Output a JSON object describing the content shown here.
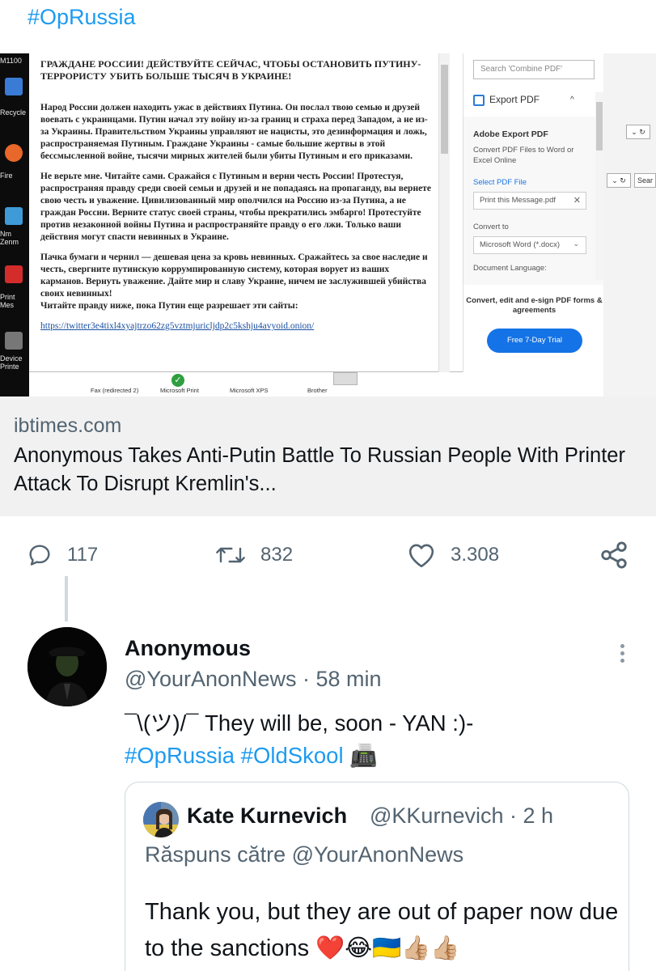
{
  "hashtag_top": "#OpRussia",
  "card_image": {
    "desktop_labels": [
      "M1100",
      "Recycle",
      "Fire",
      "Nm\nZenm",
      "Print\nMes",
      "Device\nPrinte"
    ],
    "document": {
      "heading": "ГРАЖДАНЕ РОССИИ! ДЕЙСТВУЙТЕ СЕЙЧАС, ЧТОБЫ ОСТАНОВИТЬ ПУТИНУ-ТЕРРОРИСТУ УБИТЬ БОЛЬШЕ ТЫСЯЧ В УКРАИНЕ!",
      "p1": "Народ России должен находить ужас в действиях Путина. Он послал твою семью и друзей воевать с украинцами. Путин начал эту войну из-за границ и страха перед Западом, а не из-за Украины. Правительством Украины управляют не нацисты, это дезинформация и ложь, распространяемая Путиным. Граждане Украины - самые большие жертвы в этой бессмысленной войне, тысячи мирных жителей были убиты Путиным и его приказами.",
      "p2": "Не верьте мне. Читайте сами. Сражайся с Путиным и верни честь России! Протестуя, распространяя правду среди своей семьи и друзей и не попадаясь на пропаганду, вы вернете свою честь и уважение. Цивилизованный мир ополчился на Россию из-за Путина, а не граждан России. Верните статус своей страны, чтобы прекратились эмбарго! Протестуйте против незаконной войны Путина и распространяйте правду о его лжи. Только ваши действия могут спасти невинных в Украине.",
      "p3": "Пачка бумаги и чернил — дешевая цена за кровь невинных. Сражайтесь за свое наследие и честь, свергните путинскую коррумпированную систему, которая ворует из ваших карманов. Вернуть уважение. Дайте мир и славу Украине, ничем не заслужившей убийства своих невинных!",
      "p4": "Читайте правду ниже, пока Путин еще разрешает эти сайты:",
      "link": "https://twitter3e4tixl4xyajtrzo62zg5vztmjuricljdp2c5kshju4avyoid.onion/"
    },
    "pdf_panel": {
      "search_placeholder": "Search 'Combine PDF'",
      "export_label": "Export PDF",
      "chevron": "^",
      "title": "Adobe Export PDF",
      "desc": "Convert PDF Files to Word or Excel Online",
      "select_file": "Select PDF File",
      "file_name": "Print this Message.pdf",
      "file_close": "✕",
      "convert_to": "Convert to",
      "format": "Microsoft Word (*.docx)",
      "format_arrow": "⌄",
      "doc_language": "Document Language:",
      "promo": "Convert, edit and e-sign PDF forms & agreements",
      "trial_button": "Free 7-Day Trial"
    },
    "right_controls": [
      "⌄ ↻",
      "⌄ ↻",
      "Sear"
    ],
    "printers": [
      "Fax (redirected 2)",
      "Microsoft Print",
      "Microsoft XPS",
      "Brother"
    ]
  },
  "card": {
    "domain": "ibtimes.com",
    "title": "Anonymous Takes Anti-Putin Battle To Russian People With Printer Attack To Disrupt Kremlin's..."
  },
  "actions": {
    "replies": "117",
    "retweets": "832",
    "likes": "3.308"
  },
  "reply_tweet": {
    "name": "Anonymous",
    "handle_time": "@YourAnonNews · 58 min",
    "text_plain": "¯\\(ツ)/¯ They will be, soon - YAN :)-",
    "tags": "#OpRussia #OldSkool",
    "tag_emoji": "📠"
  },
  "quoted_tweet": {
    "name": "Kate Kurnevich",
    "handle_time": "@KKurnevich · 2 h",
    "reply_to": "Răspuns către @YourAnonNews",
    "text": "Thank you, but they are out of paper now due to the sanctions",
    "emoji": "❤️😂🇺🇦👍🏼👍🏼"
  },
  "colors": {
    "link_blue": "#1d9bf0",
    "muted_gray": "#536471",
    "card_bg": "#f1f1f1",
    "adobe_blue": "#1473e6"
  }
}
